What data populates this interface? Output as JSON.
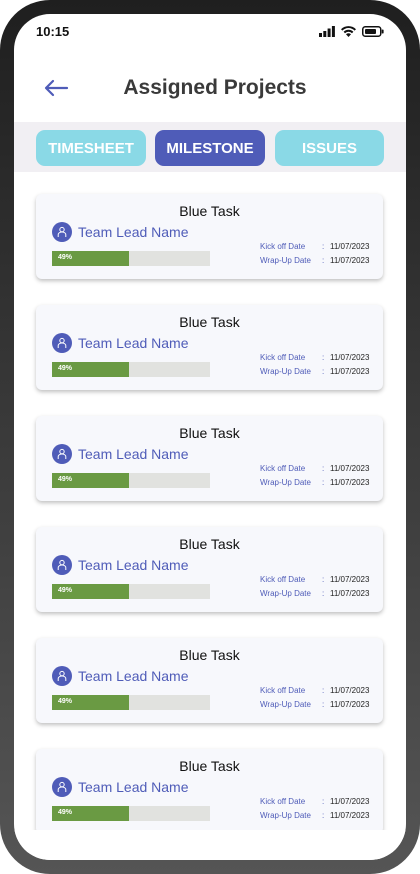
{
  "status_bar": {
    "time": "10:15",
    "icons": [
      "signal-icon",
      "wifi-icon",
      "battery-icon"
    ]
  },
  "header": {
    "title": "Assigned Projects",
    "back_icon": "arrow-left-icon"
  },
  "tabs": [
    {
      "label": "TIMESHEET",
      "active": false
    },
    {
      "label": "MILESTONE",
      "active": true
    },
    {
      "label": "ISSUES",
      "active": false
    }
  ],
  "colors": {
    "primary": "#4f5cb8",
    "tab_inactive": "#8ad9e6",
    "progress_fill": "#6a9a43",
    "progress_track": "#e1e2df"
  },
  "cards": [
    {
      "title": "Blue Task",
      "lead": "Team Lead Name",
      "progress_label": "49%",
      "progress": 0.49,
      "kickoff_label": "Kick off Date",
      "kickoff": "11/07/2023",
      "wrapup_label": "Wrap-Up Date",
      "wrapup": "11/07/2023"
    },
    {
      "title": "Blue Task",
      "lead": "Team Lead Name",
      "progress_label": "49%",
      "progress": 0.49,
      "kickoff_label": "Kick off Date",
      "kickoff": "11/07/2023",
      "wrapup_label": "Wrap-Up Date",
      "wrapup": "11/07/2023"
    },
    {
      "title": "Blue Task",
      "lead": "Team Lead Name",
      "progress_label": "49%",
      "progress": 0.49,
      "kickoff_label": "Kick off Date",
      "kickoff": "11/07/2023",
      "wrapup_label": "Wrap-Up Date",
      "wrapup": "11/07/2023"
    },
    {
      "title": "Blue Task",
      "lead": "Team Lead Name",
      "progress_label": "49%",
      "progress": 0.49,
      "kickoff_label": "Kick off Date",
      "kickoff": "11/07/2023",
      "wrapup_label": "Wrap-Up Date",
      "wrapup": "11/07/2023"
    },
    {
      "title": "Blue Task",
      "lead": "Team Lead Name",
      "progress_label": "49%",
      "progress": 0.49,
      "kickoff_label": "Kick off Date",
      "kickoff": "11/07/2023",
      "wrapup_label": "Wrap-Up Date",
      "wrapup": "11/07/2023"
    },
    {
      "title": "Blue Task",
      "lead": "Team Lead Name",
      "progress_label": "49%",
      "progress": 0.49,
      "kickoff_label": "Kick off Date",
      "kickoff": "11/07/2023",
      "wrapup_label": "Wrap-Up Date",
      "wrapup": "11/07/2023"
    }
  ]
}
